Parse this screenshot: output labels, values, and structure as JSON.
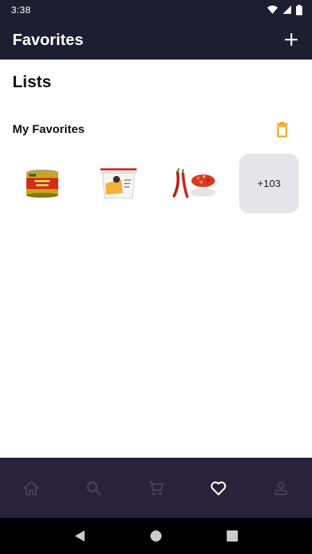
{
  "status_bar": {
    "time": "3:38"
  },
  "app_bar": {
    "title": "Favorites"
  },
  "section": {
    "title": "Lists"
  },
  "favorites_list": {
    "name": "My Favorites",
    "more_count": "+103",
    "thumbnails": [
      "rosin-sauce-can-icon",
      "cheese-bucket-icon",
      "chili-peppers-icon"
    ]
  },
  "bottom_nav": {
    "items": [
      "home-icon",
      "search-icon",
      "cart-icon",
      "heart-icon",
      "profile-icon"
    ],
    "active": "heart-icon"
  },
  "colors": {
    "app_bar": "#1e1e33",
    "bottom_nav": "#29223a",
    "accent": "#f5a623",
    "inactive_icon": "#4a4358",
    "active_icon": "#ffffff",
    "more_tile": "#e5e5ea"
  }
}
